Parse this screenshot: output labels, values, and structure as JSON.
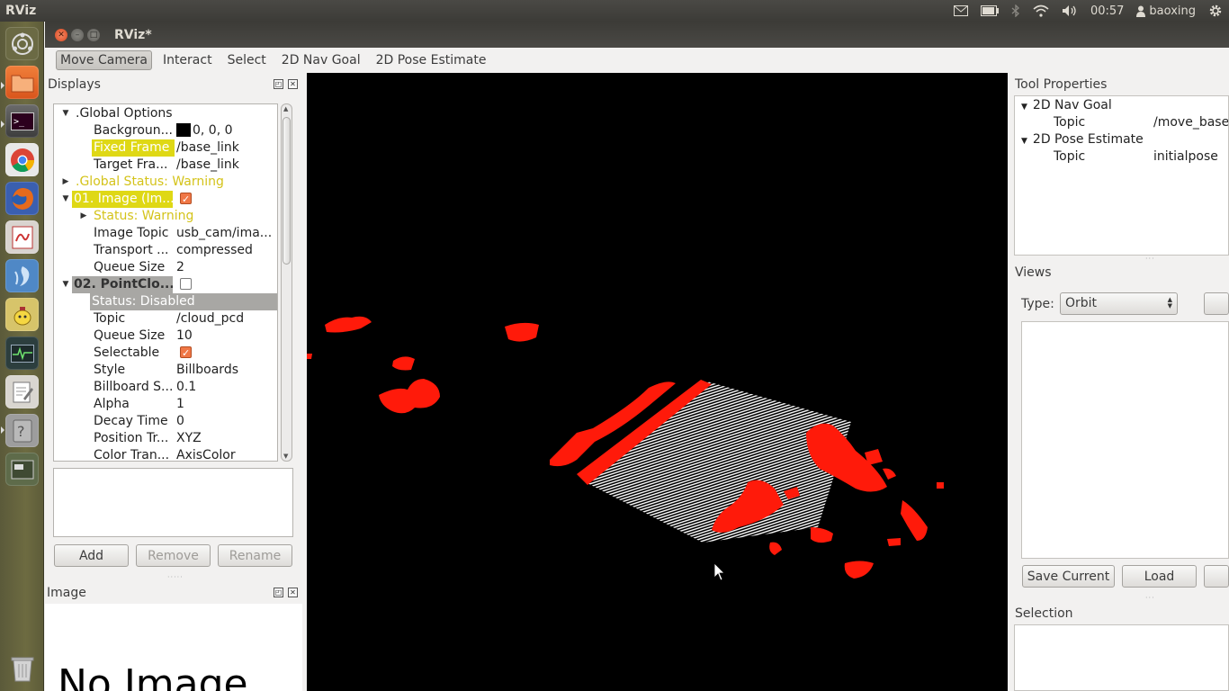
{
  "top_panel": {
    "app_name": "RViz",
    "clock": "00:57",
    "user": "baoxing",
    "icons": [
      "mail-icon",
      "battery-icon",
      "bluetooth-icon",
      "wifi-icon",
      "volume-icon",
      "user-icon",
      "gear-icon"
    ]
  },
  "launcher": {
    "items": [
      "ubuntu-dash-icon",
      "files-icon",
      "terminal-icon",
      "chrome-icon",
      "firefox-icon",
      "document-viewer-icon",
      "app-icon",
      "kettle-icon",
      "system-monitor-icon",
      "text-editor-icon",
      "help-icon",
      "workspace-icon",
      "trash-icon"
    ]
  },
  "window": {
    "title": "RViz*"
  },
  "toolbar": {
    "move_camera": "Move Camera",
    "interact": "Interact",
    "select": "Select",
    "nav_goal": "2D Nav Goal",
    "pose_estimate": "2D Pose Estimate"
  },
  "displays": {
    "title": "Displays",
    "rows": [
      {
        "label": ".Global Options",
        "value": ""
      },
      {
        "label": "Backgroun...",
        "value": "0, 0, 0"
      },
      {
        "label": "Fixed Frame",
        "value": "/base_link"
      },
      {
        "label": "Target Fra...",
        "value": "/base_link"
      },
      {
        "label": ".Global Status: Warning",
        "value": ""
      },
      {
        "label": "01. Image (Im...",
        "value": ""
      },
      {
        "label": "Status: Warning",
        "value": ""
      },
      {
        "label": "Image Topic",
        "value": "usb_cam/ima..."
      },
      {
        "label": "Transport ...",
        "value": "compressed"
      },
      {
        "label": "Queue Size",
        "value": "2"
      },
      {
        "label": "02. PointClo...",
        "value": ""
      },
      {
        "label": "Status: Disabled",
        "value": ""
      },
      {
        "label": "Topic",
        "value": "/cloud_pcd"
      },
      {
        "label": "Queue Size",
        "value": "10"
      },
      {
        "label": "Selectable",
        "value": ""
      },
      {
        "label": "Style",
        "value": "Billboards"
      },
      {
        "label": "Billboard S...",
        "value": "0.1"
      },
      {
        "label": "Alpha",
        "value": "1"
      },
      {
        "label": "Decay Time",
        "value": "0"
      },
      {
        "label": "Position Tr...",
        "value": "XYZ"
      },
      {
        "label": "Color Tran...",
        "value": "AxisColor"
      }
    ],
    "buttons": {
      "add": "Add",
      "remove": "Remove",
      "rename": "Rename"
    }
  },
  "image_panel": {
    "title": "Image",
    "placeholder": "No Image"
  },
  "tool_properties": {
    "title": "Tool Properties",
    "rows": [
      {
        "label": "2D Nav Goal",
        "value": ""
      },
      {
        "label": "Topic",
        "value": "/move_base_"
      },
      {
        "label": "2D Pose Estimate",
        "value": ""
      },
      {
        "label": "Topic",
        "value": "initialpose"
      }
    ]
  },
  "views": {
    "title": "Views",
    "type_label": "Type:",
    "type_value": "Orbit",
    "save_current": "Save Current",
    "load": "Load"
  },
  "selection": {
    "title": "Selection"
  },
  "colors": {
    "point_cloud_white": "#ffffff",
    "point_cloud_red": "#ff1a0a",
    "viewport_bg": "#000000",
    "highlight_yellow": "#dfd815"
  }
}
